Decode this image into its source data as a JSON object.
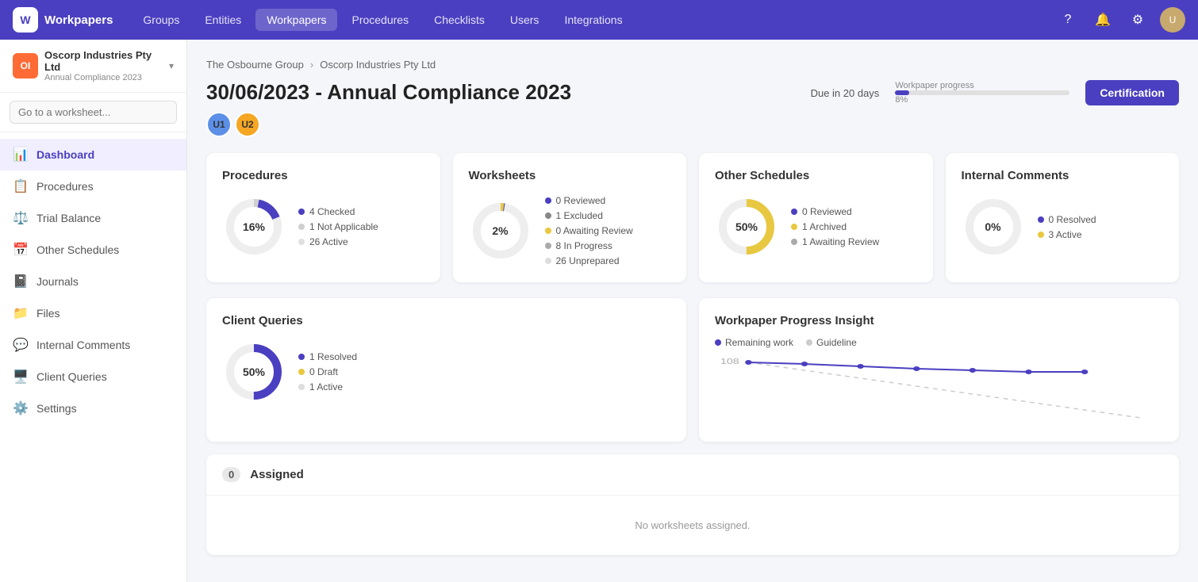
{
  "nav": {
    "logo_text": "Workpapers",
    "links": [
      "Groups",
      "Entities",
      "Workpapers",
      "Procedures",
      "Checklists",
      "Users",
      "Integrations"
    ],
    "active_link": "Workpapers"
  },
  "sidebar": {
    "org_name": "Oscorp Industries Pty Ltd",
    "org_sub": "Annual Compliance 2023",
    "search_placeholder": "Go to a worksheet...",
    "items": [
      {
        "label": "Dashboard",
        "icon": "📊",
        "active": true
      },
      {
        "label": "Procedures",
        "icon": "📋",
        "active": false
      },
      {
        "label": "Trial Balance",
        "icon": "⚖️",
        "active": false
      },
      {
        "label": "Other Schedules",
        "icon": "📅",
        "active": false
      },
      {
        "label": "Journals",
        "icon": "📓",
        "active": false
      },
      {
        "label": "Files",
        "icon": "📁",
        "active": false
      },
      {
        "label": "Internal Comments",
        "icon": "💬",
        "active": false
      },
      {
        "label": "Client Queries",
        "icon": "🖥️",
        "active": false
      },
      {
        "label": "Settings",
        "icon": "⚙️",
        "active": false
      }
    ]
  },
  "breadcrumb": {
    "items": [
      "The Osbourne Group",
      "Oscorp Industries Pty Ltd"
    ]
  },
  "page": {
    "title": "30/06/2023 - Annual Compliance 2023",
    "due_text": "Due in 20 days",
    "progress_label": "Workpaper progress",
    "progress_pct": "8%",
    "progress_value": 8,
    "cert_button": "Certification"
  },
  "cards": {
    "procedures": {
      "title": "Procedures",
      "pct": "16%",
      "pct_value": 16,
      "legend": [
        {
          "label": "4 Checked",
          "color": "#4a3fc0"
        },
        {
          "label": "1 Not Applicable",
          "color": "#e8e8e8"
        },
        {
          "label": "26 Active",
          "color": "#e0e0e0"
        }
      ],
      "donut_segments": [
        {
          "value": 16,
          "color": "#4a3fc0"
        },
        {
          "value": 3,
          "color": "#d0d0d0"
        },
        {
          "value": 81,
          "color": "#eeeeee"
        }
      ]
    },
    "worksheets": {
      "title": "Worksheets",
      "pct": "2%",
      "pct_value": 2,
      "legend": [
        {
          "label": "0 Reviewed",
          "color": "#4a3fc0"
        },
        {
          "label": "1 Excluded",
          "color": "#888"
        },
        {
          "label": "0 Awaiting Review",
          "color": "#e8c840"
        },
        {
          "label": "8 In Progress",
          "color": "#aaa"
        },
        {
          "label": "26 Unprepared",
          "color": "#ddd"
        }
      ]
    },
    "other_schedules": {
      "title": "Other Schedules",
      "pct": "50%",
      "pct_value": 50,
      "legend": [
        {
          "label": "0 Reviewed",
          "color": "#4a3fc0"
        },
        {
          "label": "1 Archived",
          "color": "#e8c840"
        },
        {
          "label": "1 Awaiting Review",
          "color": "#aaa"
        }
      ]
    },
    "internal_comments": {
      "title": "Internal Comments",
      "pct": "0%",
      "pct_value": 0,
      "legend": [
        {
          "label": "0 Resolved",
          "color": "#4a3fc0"
        },
        {
          "label": "3 Active",
          "color": "#e8c840"
        }
      ]
    }
  },
  "client_queries": {
    "title": "Client Queries",
    "pct": "50%",
    "pct_value": 50,
    "legend": [
      {
        "label": "1 Resolved",
        "color": "#4a3fc0"
      },
      {
        "label": "0 Draft",
        "color": "#e8c840"
      },
      {
        "label": "1 Active",
        "color": "#ddd"
      }
    ]
  },
  "assigned": {
    "title": "Assigned",
    "count": "0",
    "empty_message": "No worksheets assigned."
  },
  "insight": {
    "title": "Workpaper Progress Insight",
    "legend": {
      "remaining": "Remaining work",
      "guideline": "Guideline"
    },
    "y_label": "108"
  }
}
